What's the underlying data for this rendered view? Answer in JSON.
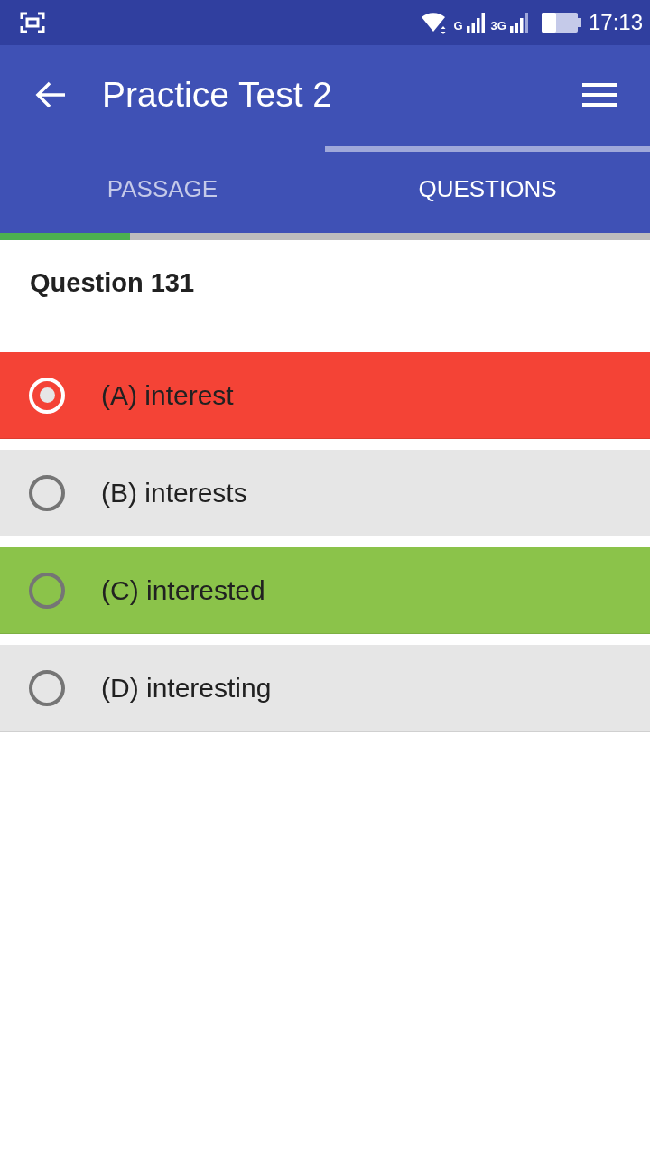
{
  "status_bar": {
    "network_labels": [
      "G",
      "3G"
    ],
    "time": "17:13"
  },
  "toolbar": {
    "title": "Practice Test 2"
  },
  "tabs": [
    {
      "label": "PASSAGE",
      "selected": false
    },
    {
      "label": "QUESTIONS",
      "selected": true
    }
  ],
  "progress": {
    "level": 0.2
  },
  "question": {
    "title": "Question 131"
  },
  "options": [
    {
      "label": "(A) interest",
      "selected": true,
      "color": "#f44336"
    },
    {
      "label": "(B) interests",
      "selected": false,
      "color": "#e6e6e6"
    },
    {
      "label": "(C) interested",
      "selected": false,
      "color": "#8bc34a"
    },
    {
      "label": "(D) interesting",
      "selected": false,
      "color": "#e6e6e6"
    }
  ]
}
